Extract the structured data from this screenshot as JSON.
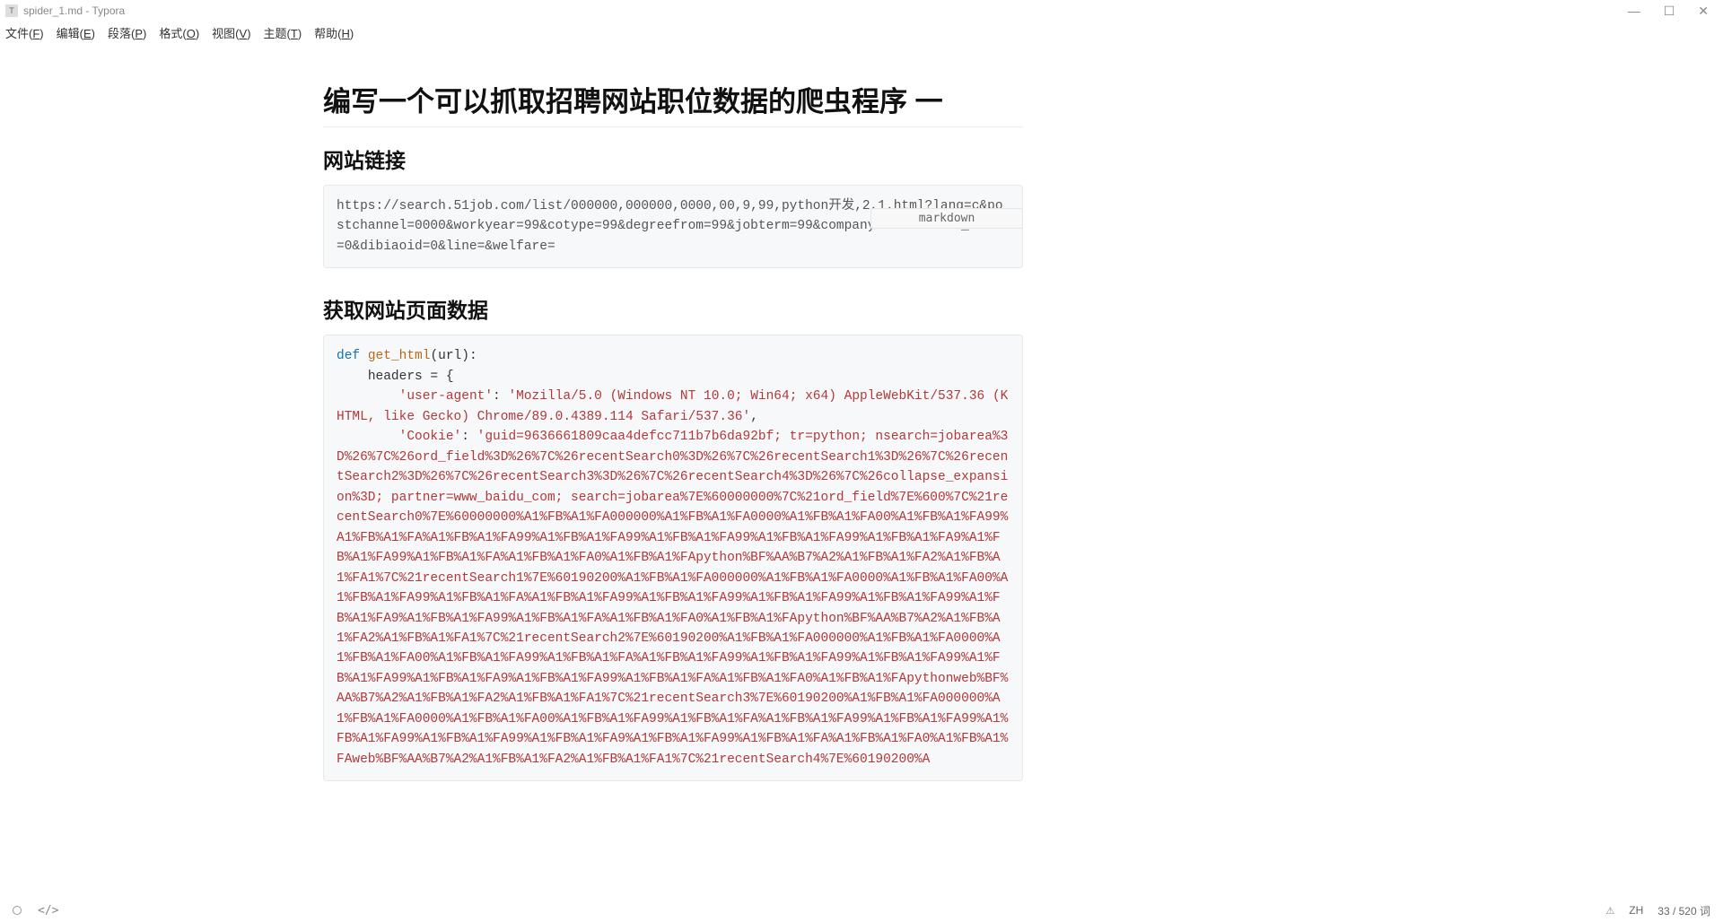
{
  "window": {
    "icon_letter": "T",
    "title": "spider_1.md - Typora"
  },
  "menubar": {
    "items": [
      {
        "label": "文件(F)",
        "key": "F"
      },
      {
        "label": "编辑(E)",
        "key": "E"
      },
      {
        "label": "段落(P)",
        "key": "P"
      },
      {
        "label": "格式(O)",
        "key": "O"
      },
      {
        "label": "视图(V)",
        "key": "V"
      },
      {
        "label": "主题(T)",
        "key": "T"
      },
      {
        "label": "帮助(H)",
        "key": "H"
      }
    ]
  },
  "content": {
    "h1": "编写一个可以抓取招聘网站职位数据的爬虫程序 一",
    "h2a": "网站链接",
    "code1": "https://search.51job.com/list/000000,000000,0000,00,9,99,python开发,2,1.html?lang=c&postchannel=0000&workyear=99&cotype=99&degreefrom=99&jobterm=99&companysize=99&ord_field=0&dibiaoid=0&line=&welfare=",
    "code1_lang_label": "markdown",
    "h2b": "获取网站页面数据",
    "py": {
      "l1_def": "def",
      "l1_fn": "get_html",
      "l1_rest": "(url):",
      "l2": "    headers = {",
      "l3a": "        ",
      "l3_k": "'user-agent'",
      "l3_c": ": ",
      "l3_v": "'Mozilla/5.0 (Windows NT 10.0; Win64; x64) AppleWebKit/537.36 (KHTML, like Gecko) Chrome/89.0.4389.114 Safari/537.36'",
      "l3_comma": ",",
      "l4a": "        ",
      "l4_k": "'Cookie'",
      "l4_c": ": ",
      "l4_v": "'guid=9636661809caa4defcc711b7b6da92bf; tr=python; nsearch=jobarea%3D%26%7C%26ord_field%3D%26%7C%26recentSearch0%3D%26%7C%26recentSearch1%3D%26%7C%26recentSearch2%3D%26%7C%26recentSearch3%3D%26%7C%26recentSearch4%3D%26%7C%26collapse_expansion%3D; partner=www_baidu_com; search=jobarea%7E%60000000%7C%21ord_field%7E%600%7C%21recentSearch0%7E%60000000%A1%FB%A1%FA000000%A1%FB%A1%FA0000%A1%FB%A1%FA00%A1%FB%A1%FA99%A1%FB%A1%FA%A1%FB%A1%FA99%A1%FB%A1%FA99%A1%FB%A1%FA99%A1%FB%A1%FA99%A1%FB%A1%FA9%A1%FB%A1%FA99%A1%FB%A1%FA%A1%FB%A1%FA0%A1%FB%A1%FApython%BF%AA%B7%A2%A1%FB%A1%FA2%A1%FB%A1%FA1%7C%21recentSearch1%7E%60190200%A1%FB%A1%FA000000%A1%FB%A1%FA0000%A1%FB%A1%FA00%A1%FB%A1%FA99%A1%FB%A1%FA%A1%FB%A1%FA99%A1%FB%A1%FA99%A1%FB%A1%FA99%A1%FB%A1%FA99%A1%FB%A1%FA9%A1%FB%A1%FA99%A1%FB%A1%FA%A1%FB%A1%FA0%A1%FB%A1%FApython%BF%AA%B7%A2%A1%FB%A1%FA2%A1%FB%A1%FA1%7C%21recentSearch2%7E%60190200%A1%FB%A1%FA000000%A1%FB%A1%FA0000%A1%FB%A1%FA00%A1%FB%A1%FA99%A1%FB%A1%FA%A1%FB%A1%FA99%A1%FB%A1%FA99%A1%FB%A1%FA99%A1%FB%A1%FA99%A1%FB%A1%FA9%A1%FB%A1%FA99%A1%FB%A1%FA%A1%FB%A1%FA0%A1%FB%A1%FApythonweb%BF%AA%B7%A2%A1%FB%A1%FA2%A1%FB%A1%FA1%7C%21recentSearch3%7E%60190200%A1%FB%A1%FA000000%A1%FB%A1%FA0000%A1%FB%A1%FA00%A1%FB%A1%FA99%A1%FB%A1%FA%A1%FB%A1%FA99%A1%FB%A1%FA99%A1%FB%A1%FA99%A1%FB%A1%FA99%A1%FB%A1%FA9%A1%FB%A1%FA99%A1%FB%A1%FA%A1%FB%A1%FA0%A1%FB%A1%FAweb%BF%AA%B7%A2%A1%FB%A1%FA2%A1%FB%A1%FA1%7C%21recentSearch4%7E%60190200%A"
    }
  },
  "statusbar": {
    "lang": "ZH",
    "wordcount": "33 / 520 词"
  }
}
